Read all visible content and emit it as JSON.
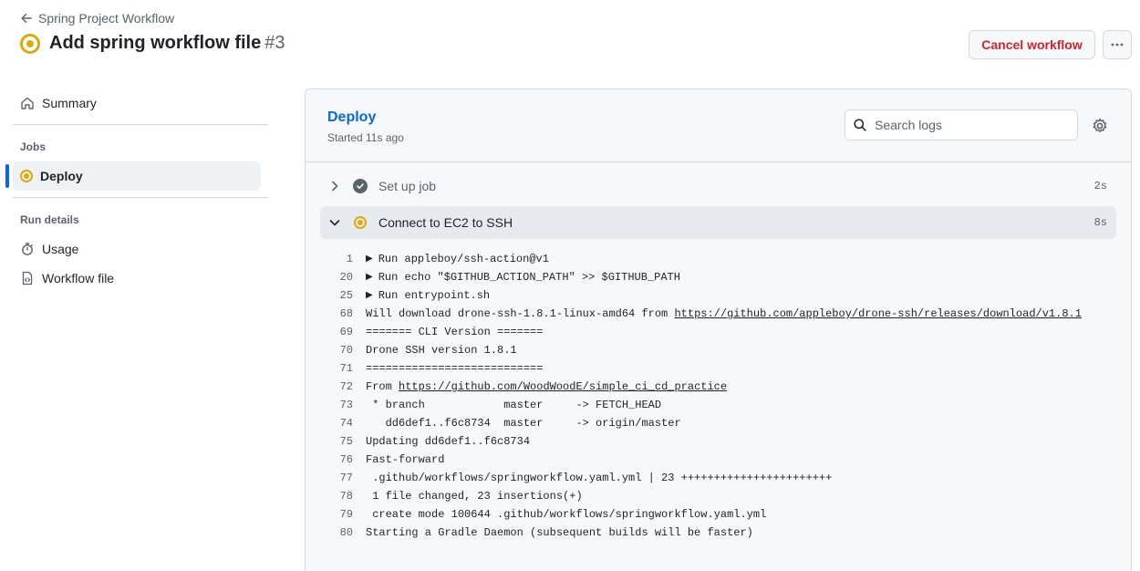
{
  "header": {
    "back_label": "Spring Project Workflow",
    "title": "Add spring workflow file",
    "run_number": "#3",
    "cancel_label": "Cancel workflow"
  },
  "sidebar": {
    "summary_label": "Summary",
    "jobs_heading": "Jobs",
    "job_label": "Deploy",
    "run_details_heading": "Run details",
    "usage_label": "Usage",
    "workflow_file_label": "Workflow file"
  },
  "job": {
    "name": "Deploy",
    "started": "Started 11s ago",
    "search_placeholder": "Search logs"
  },
  "steps": [
    {
      "label": "Set up job",
      "time": "2s",
      "status": "success"
    },
    {
      "label": "Connect to EC2 to SSH",
      "time": "8s",
      "status": "in_progress"
    }
  ],
  "log": [
    {
      "n": "1",
      "collapsible": true,
      "text": "Run appleboy/ssh-action@v1",
      "link": "",
      "after": ""
    },
    {
      "n": "20",
      "collapsible": true,
      "text": "Run echo \"$GITHUB_ACTION_PATH\" >> $GITHUB_PATH",
      "link": "",
      "after": ""
    },
    {
      "n": "25",
      "collapsible": true,
      "text": "Run entrypoint.sh",
      "link": "",
      "after": ""
    },
    {
      "n": "68",
      "collapsible": false,
      "text": "Will download drone-ssh-1.8.1-linux-amd64 from ",
      "link": "https://github.com/appleboy/drone-ssh/releases/download/v1.8.1",
      "after": ""
    },
    {
      "n": "69",
      "collapsible": false,
      "text": "======= CLI Version =======",
      "link": "",
      "after": ""
    },
    {
      "n": "70",
      "collapsible": false,
      "text": "Drone SSH version 1.8.1",
      "link": "",
      "after": ""
    },
    {
      "n": "71",
      "collapsible": false,
      "text": "===========================",
      "link": "",
      "after": ""
    },
    {
      "n": "72",
      "collapsible": false,
      "text": "From ",
      "link": "https://github.com/WoodWoodE/simple_ci_cd_practice",
      "after": ""
    },
    {
      "n": "73",
      "collapsible": false,
      "text": " * branch            master     -> FETCH_HEAD",
      "link": "",
      "after": ""
    },
    {
      "n": "74",
      "collapsible": false,
      "text": "   dd6def1..f6c8734  master     -> origin/master",
      "link": "",
      "after": ""
    },
    {
      "n": "75",
      "collapsible": false,
      "text": "Updating dd6def1..f6c8734",
      "link": "",
      "after": ""
    },
    {
      "n": "76",
      "collapsible": false,
      "text": "Fast-forward",
      "link": "",
      "after": ""
    },
    {
      "n": "77",
      "collapsible": false,
      "text": " .github/workflows/springworkflow.yaml.yml | 23 +++++++++++++++++++++++",
      "link": "",
      "after": ""
    },
    {
      "n": "78",
      "collapsible": false,
      "text": " 1 file changed, 23 insertions(+)",
      "link": "",
      "after": ""
    },
    {
      "n": "79",
      "collapsible": false,
      "text": " create mode 100644 .github/workflows/springworkflow.yaml.yml",
      "link": "",
      "after": ""
    },
    {
      "n": "80",
      "collapsible": false,
      "text": "Starting a Gradle Daemon (subsequent builds will be faster)",
      "link": "",
      "after": ""
    }
  ],
  "icons": {
    "back": "arrow-left-icon",
    "status": "in-progress-icon",
    "more": "kebab-horizontal-icon",
    "summary": "home-icon",
    "usage": "stopwatch-icon",
    "workflow_file": "file-code-icon",
    "search": "search-icon",
    "settings": "gear-icon",
    "collapsed": "chevron-right-icon",
    "expanded": "chevron-down-icon",
    "success": "check-circle-icon"
  },
  "colors": {
    "accent": "#0969da",
    "in_progress": "#dbab0a",
    "danger": "#d1242f",
    "muted": "#59636e"
  }
}
